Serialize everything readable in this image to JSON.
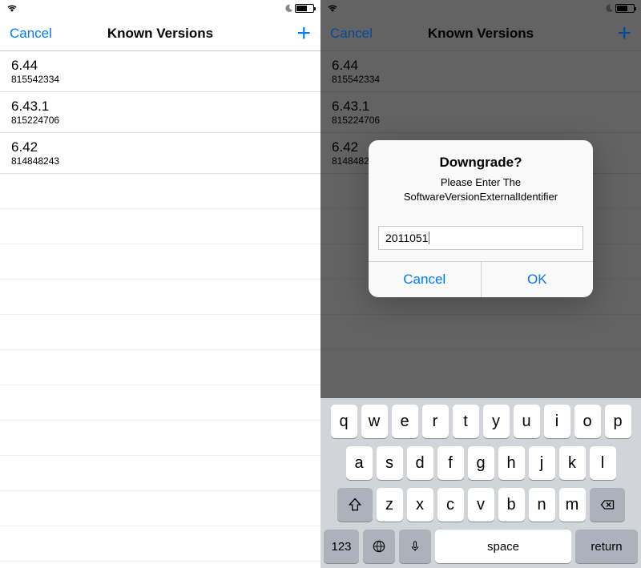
{
  "nav": {
    "cancel": "Cancel",
    "title": "Known Versions"
  },
  "versions": [
    {
      "name": "6.44",
      "id": "815542334"
    },
    {
      "name": "6.43.1",
      "id": "815224706"
    },
    {
      "name": "6.42",
      "id": "814848243"
    }
  ],
  "versions_right": [
    {
      "name": "6.44",
      "id": "815542334"
    },
    {
      "name": "6.43.1",
      "id": "815224706"
    },
    {
      "name": "6.42",
      "id": "8148482"
    }
  ],
  "alert": {
    "title": "Downgrade?",
    "message_line1": "Please Enter The",
    "message_line2": "SoftwareVersionExternalIdentifier",
    "input_value": "2011051",
    "cancel": "Cancel",
    "ok": "OK"
  },
  "keyboard": {
    "row1": [
      "q",
      "w",
      "e",
      "r",
      "t",
      "y",
      "u",
      "i",
      "o",
      "p"
    ],
    "row2": [
      "a",
      "s",
      "d",
      "f",
      "g",
      "h",
      "j",
      "k",
      "l"
    ],
    "row3": [
      "z",
      "x",
      "c",
      "v",
      "b",
      "n",
      "m"
    ],
    "num": "123",
    "space": "space",
    "ret": "return"
  }
}
